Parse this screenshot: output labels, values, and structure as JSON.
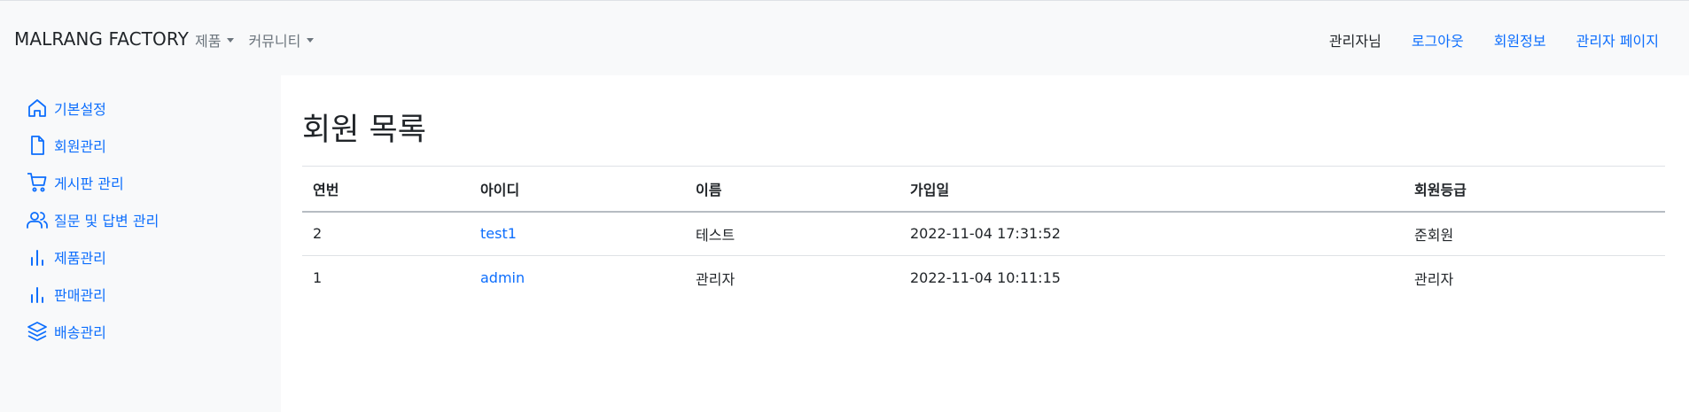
{
  "navbar": {
    "brand": "MALRANG FACTORY",
    "menus": [
      {
        "label": "제품"
      },
      {
        "label": "커뮤니티"
      }
    ],
    "user_text": "관리자님",
    "links": {
      "logout": "로그아웃",
      "member_info": "회원정보",
      "admin_page": "관리자 페이지"
    }
  },
  "sidebar": {
    "items": [
      {
        "label": "기본설정",
        "icon": "home-icon"
      },
      {
        "label": "회원관리",
        "icon": "file-icon"
      },
      {
        "label": "게시판 관리",
        "icon": "shopping-cart-icon"
      },
      {
        "label": "질문 및 답변 관리",
        "icon": "users-icon"
      },
      {
        "label": "제품관리",
        "icon": "bar-chart-icon"
      },
      {
        "label": "판매관리",
        "icon": "bar-chart-icon"
      },
      {
        "label": "배송관리",
        "icon": "layers-icon"
      }
    ]
  },
  "main": {
    "title": "회원 목록",
    "table": {
      "headers": [
        "연번",
        "아이디",
        "이름",
        "가입일",
        "회원등급"
      ],
      "rows": [
        {
          "no": "2",
          "id": "test1",
          "name": "테스트",
          "joined": "2022-11-04 17:31:52",
          "grade": "준회원"
        },
        {
          "no": "1",
          "id": "admin",
          "name": "관리자",
          "joined": "2022-11-04 10:11:15",
          "grade": "관리자"
        }
      ]
    }
  },
  "colors": {
    "accent": "#0d6efd",
    "sidebar_bg": "#f8f9fa",
    "muted": "#6c757d"
  }
}
